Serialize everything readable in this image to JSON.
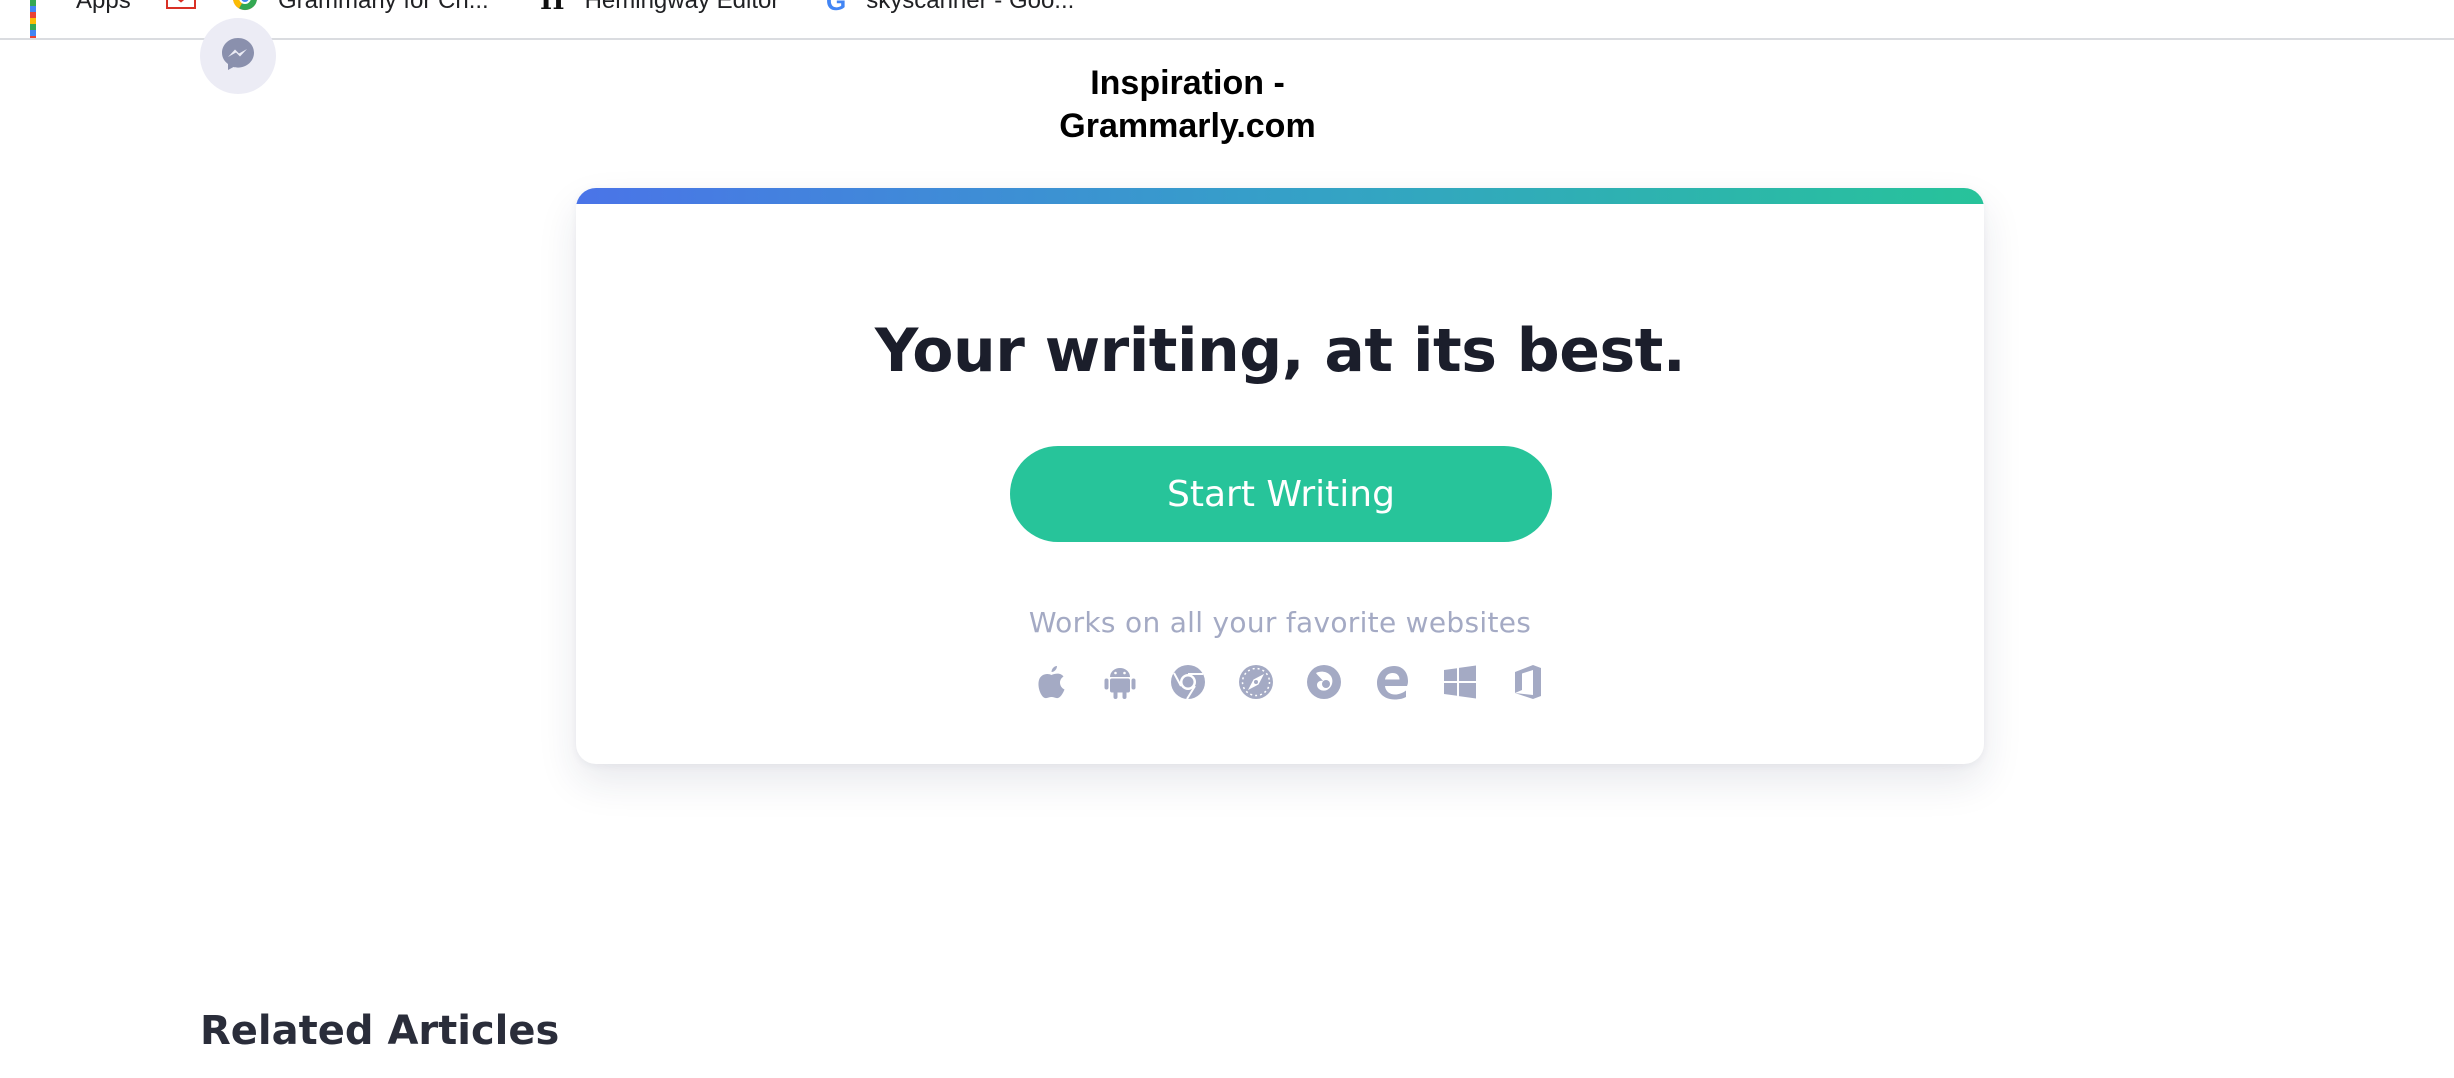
{
  "bookmarks": [
    {
      "label": "Apps",
      "icon": "apps-grid-icon"
    },
    {
      "label": "",
      "icon": "gmail-icon"
    },
    {
      "label": "Grammarly for Ch...",
      "icon": "chrome-web-store-icon"
    },
    {
      "label": "Hemingway Editor",
      "icon": "hemingway-icon",
      "glyph": "H"
    },
    {
      "label": "skyscanner - Goo...",
      "icon": "google-icon",
      "glyph": "G"
    }
  ],
  "messenger": {
    "icon": "messenger-icon"
  },
  "page_title": {
    "line1": "Inspiration -",
    "line2": "Grammarly.com"
  },
  "card": {
    "headline": "Your writing, at its best.",
    "cta_label": "Start Writing",
    "works_text": "Works on all your favorite websites",
    "platforms": [
      "apple-icon",
      "android-icon",
      "chrome-icon",
      "safari-icon",
      "firefox-icon",
      "edge-icon",
      "windows-icon",
      "office-icon"
    ],
    "colors": {
      "accent": "#27c49a",
      "gradient_start": "#4a74e8",
      "gradient_end": "#27c39a",
      "muted": "#a4aac4"
    }
  },
  "related": {
    "heading": "Related Articles"
  }
}
